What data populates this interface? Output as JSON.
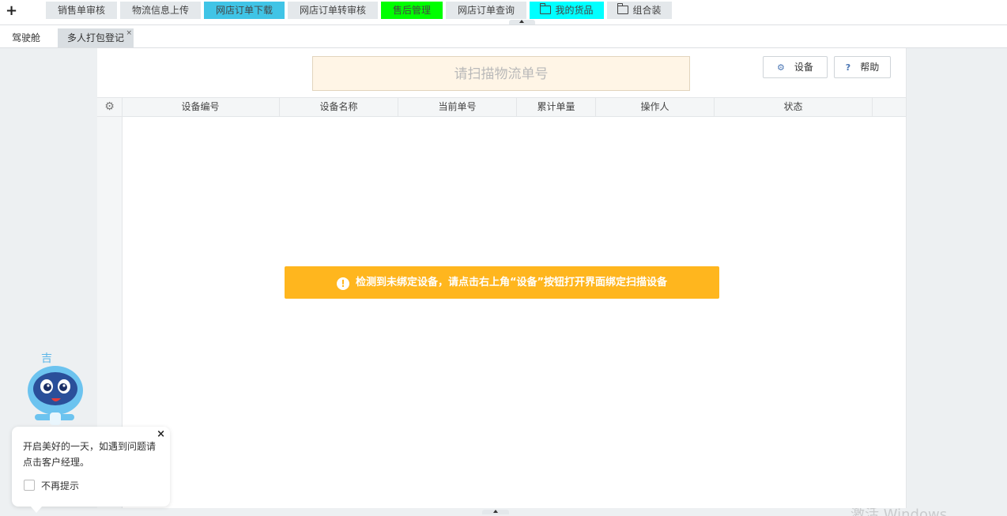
{
  "toolbar": {
    "add_icon": "plus-icon",
    "tabs": [
      {
        "label": "销售单审核",
        "bg": "#e4e8eb"
      },
      {
        "label": "物流信息上传",
        "bg": "#e4e8eb"
      },
      {
        "label": "网店订单下载",
        "bg": "#40c4e6"
      },
      {
        "label": "网店订单转审核",
        "bg": "#e4e8eb"
      },
      {
        "label": "售后管理",
        "bg": "#00ff00"
      },
      {
        "label": "网店订单查询",
        "bg": "#e4e8eb"
      },
      {
        "label": "我的货品",
        "bg": "#00ffff",
        "icon": "folder-icon"
      },
      {
        "label": "组合装",
        "bg": "#e4e8eb",
        "icon": "folder-icon"
      }
    ]
  },
  "page_tabs": [
    {
      "label": "驾驶舱"
    },
    {
      "label": "多人打包登记",
      "active": true,
      "close": "×"
    }
  ],
  "main": {
    "scan_placeholder": "请扫描物流单号",
    "settings_button": {
      "label": "设备",
      "icon": "gear-icon"
    },
    "help_button": {
      "label": "帮助",
      "icon": "question-icon",
      "icon_text": "?"
    },
    "columns": [
      "设备编号",
      "设备名称",
      "当前单号",
      "累计单量",
      "操作人",
      "状态"
    ],
    "warning": "检测到未绑定设备，请点击右上角“设备”按钮打开界面绑定扫描设备",
    "warning_color": "#ffb61e"
  },
  "assistant": {
    "message": "开启美好的一天，如遇到问题请点击客户经理。",
    "dont_show_label": "不再提示",
    "close": "×"
  },
  "watermark": "激活 Windows"
}
